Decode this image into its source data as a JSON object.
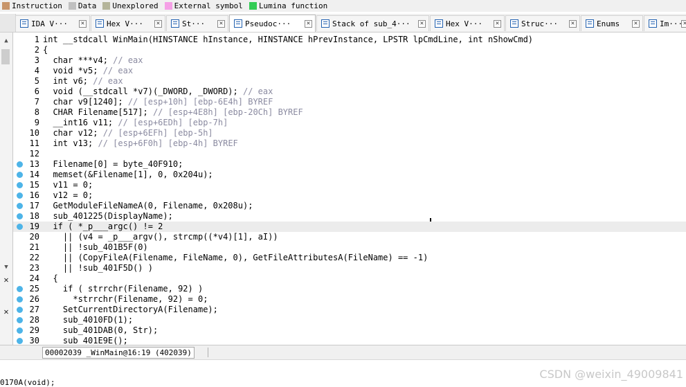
{
  "legend": [
    {
      "label": "Instruction",
      "color": "#c8956a"
    },
    {
      "label": "Data",
      "color": "#c0c0c0"
    },
    {
      "label": "Unexplored",
      "color": "#b5b59a"
    },
    {
      "label": "External symbol",
      "color": "#f5a0e6"
    },
    {
      "label": "Lumina function",
      "color": "#33cc55"
    }
  ],
  "tabs": [
    {
      "label": "IDA V···",
      "icon": "ida-view-icon",
      "active": false
    },
    {
      "label": "Hex V···",
      "icon": "hex-view-icon",
      "active": false
    },
    {
      "label": "St···",
      "icon": "strings-icon",
      "active": false
    },
    {
      "label": "Pseudoc···",
      "icon": "pseudocode-icon",
      "active": true
    },
    {
      "label": "Stack of sub_4···",
      "icon": "stack-icon",
      "active": false
    },
    {
      "label": "Hex V···",
      "icon": "hex-view-icon",
      "active": false
    },
    {
      "label": "Struc···",
      "icon": "structures-icon",
      "active": false
    },
    {
      "label": "Enums",
      "icon": "enums-icon",
      "active": false
    },
    {
      "label": "Im···",
      "icon": "imports-icon",
      "active": false
    }
  ],
  "code_lines": [
    {
      "num": "1",
      "dot": false,
      "text": "int __stdcall WinMain(HINSTANCE hInstance, HINSTANCE hPrevInstance, LPSTR lpCmdLine, int nShowCmd)"
    },
    {
      "num": "2",
      "dot": false,
      "text": "{"
    },
    {
      "num": "3",
      "dot": false,
      "text": "  char ***v4; // eax"
    },
    {
      "num": "4",
      "dot": false,
      "text": "  void *v5; // eax"
    },
    {
      "num": "5",
      "dot": false,
      "text": "  int v6; // eax"
    },
    {
      "num": "6",
      "dot": false,
      "text": "  void (__stdcall *v7)(_DWORD, _DWORD); // eax"
    },
    {
      "num": "7",
      "dot": false,
      "text": "  char v9[1240]; // [esp+10h] [ebp-6E4h] BYREF"
    },
    {
      "num": "8",
      "dot": false,
      "text": "  CHAR Filename[517]; // [esp+4E8h] [ebp-20Ch] BYREF"
    },
    {
      "num": "9",
      "dot": false,
      "text": "  __int16 v11; // [esp+6EDh] [ebp-7h]"
    },
    {
      "num": "10",
      "dot": false,
      "text": "  char v12; // [esp+6EFh] [ebp-5h]"
    },
    {
      "num": "11",
      "dot": false,
      "text": "  int v13; // [esp+6F0h] [ebp-4h] BYREF"
    },
    {
      "num": "12",
      "dot": false,
      "text": ""
    },
    {
      "num": "13",
      "dot": true,
      "text": "  Filename[0] = byte_40F910;"
    },
    {
      "num": "14",
      "dot": true,
      "text": "  memset(&Filename[1], 0, 0x204u);"
    },
    {
      "num": "15",
      "dot": true,
      "text": "  v11 = 0;"
    },
    {
      "num": "16",
      "dot": true,
      "text": "  v12 = 0;"
    },
    {
      "num": "17",
      "dot": true,
      "text": "  GetModuleFileNameA(0, Filename, 0x208u);"
    },
    {
      "num": "18",
      "dot": true,
      "text": "  sub_401225(DisplayName);"
    },
    {
      "num": "19",
      "dot": true,
      "text": "  if ( *_p___argc() != 2"
    },
    {
      "num": "20",
      "dot": false,
      "text": "    || (v4 = _p___argv(), strcmp((*v4)[1], aI))"
    },
    {
      "num": "21",
      "dot": false,
      "text": "    || !sub_401B5F(0)"
    },
    {
      "num": "22",
      "dot": false,
      "text": "    || (CopyFileA(Filename, FileName, 0), GetFileAttributesA(FileName) == -1)"
    },
    {
      "num": "23",
      "dot": false,
      "text": "    || !sub_401F5D() )"
    },
    {
      "num": "24",
      "dot": false,
      "text": "  {"
    },
    {
      "num": "25",
      "dot": true,
      "text": "    if ( strrchr(Filename, 92) )"
    },
    {
      "num": "26",
      "dot": true,
      "text": "      *strrchr(Filename, 92) = 0;"
    },
    {
      "num": "27",
      "dot": true,
      "text": "    SetCurrentDirectoryA(Filename);"
    },
    {
      "num": "28",
      "dot": true,
      "text": "    sub_4010FD(1);"
    },
    {
      "num": "29",
      "dot": true,
      "text": "    sub_401DAB(0, Str);"
    },
    {
      "num": "30",
      "dot": true,
      "text": "    sub_401E9E();"
    }
  ],
  "current_line": "19",
  "status": {
    "location": "00002039 _WinMain@16:19 (402039)"
  },
  "output": {
    "partial_line": "0170A(void);"
  },
  "watermark": "CSDN @weixin_49009841"
}
